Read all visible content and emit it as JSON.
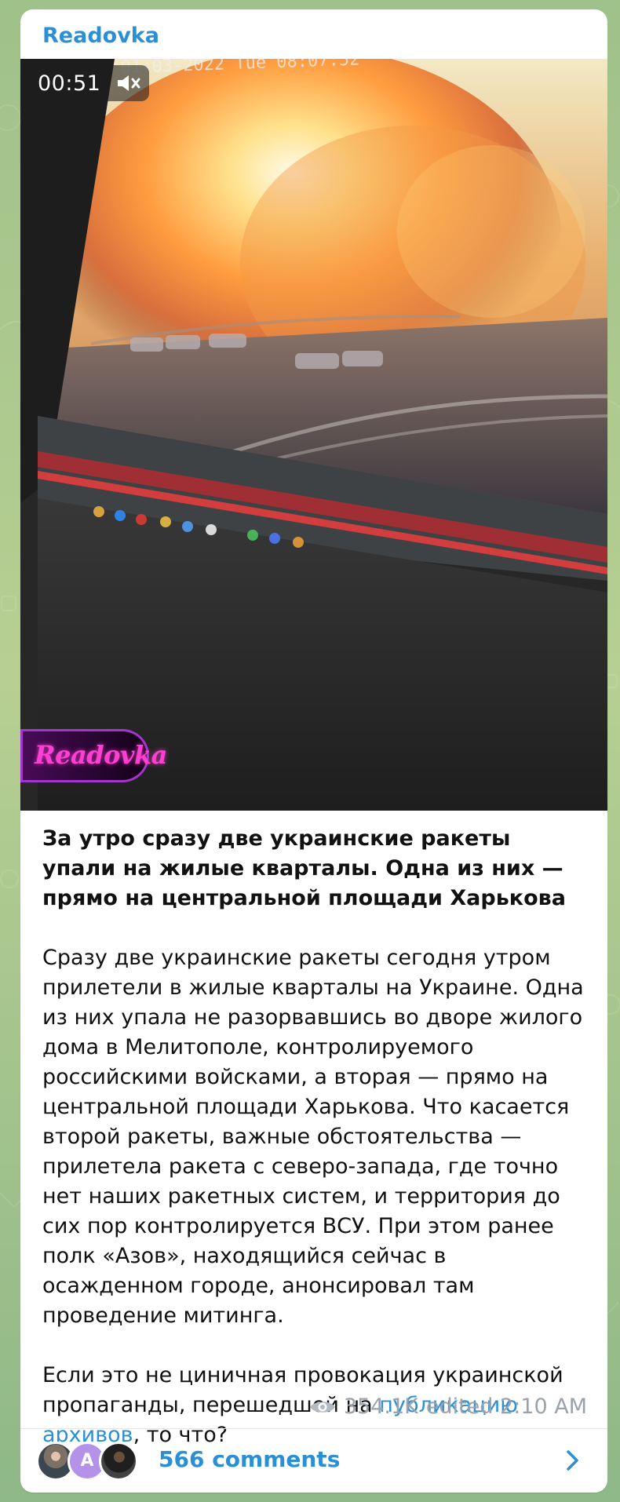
{
  "channel": {
    "name": "Readovka"
  },
  "video": {
    "duration": "00:51",
    "watermark": "Readovka"
  },
  "post": {
    "title": "За утро сразу две украинские ракеты упали на жилые кварталы. Одна из них — прямо на центральной площади Харькова",
    "paragraph": "Сразу две украинские ракеты сегодня утром прилетели в жилые кварталы на Украине. Одна из них упала не разорвавшись во дворе жилого дома в Мелитополе, контролируемого российскими войсками, а вторая — прямо на центральной площади Харькова. Что касается второй ракеты, важные обстоятельства — прилетела ракета с северо-запада, где точно нет наших ракетных систем, и территория до сих пор контролируется ВСУ. При этом ранее полк «Азов», находящийся сейчас в осажденном городе, анонсировал там проведение митинга.",
    "final_prefix": "Если это не циничная провокация украинской пропаганды, перешедшей на ",
    "final_link": "публикацию архивов",
    "final_suffix": ", то что?"
  },
  "meta": {
    "views": "354.1K",
    "edited": "edited 2:10 AM"
  },
  "comments": {
    "avatar_letter": "A",
    "label": "566 comments"
  }
}
